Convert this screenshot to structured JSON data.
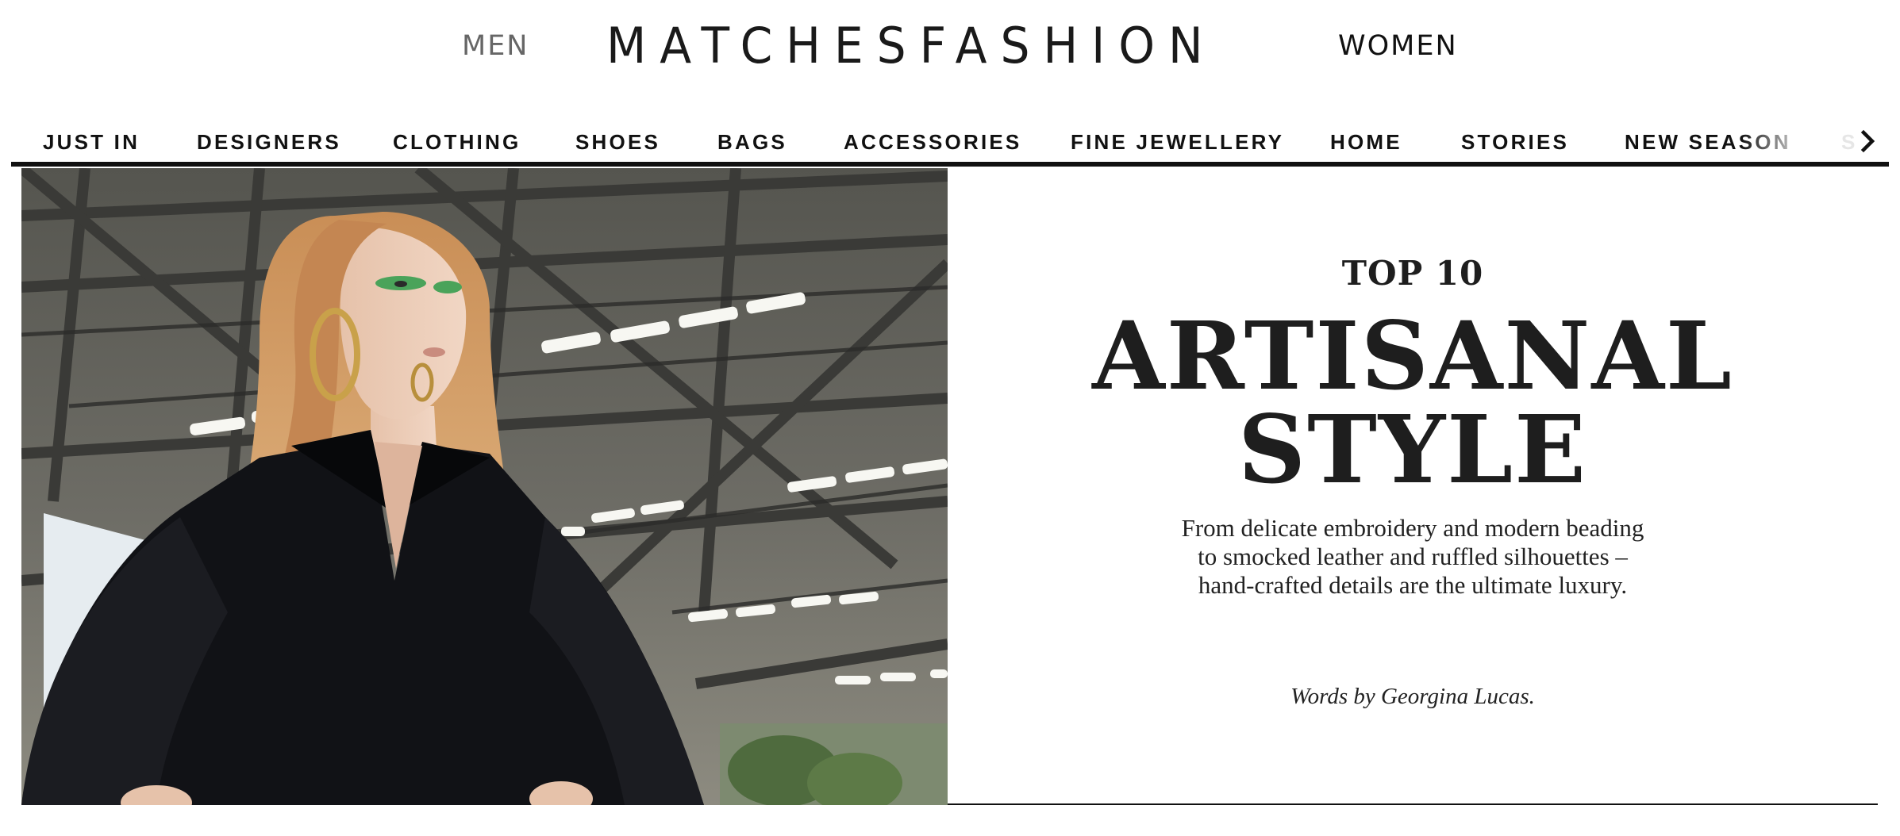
{
  "header": {
    "men_label": "MEN",
    "logo_text": "MATCHESFASHION",
    "women_label": "WOMEN"
  },
  "nav": {
    "items": [
      "JUST IN",
      "DESIGNERS",
      "CLOTHING",
      "SHOES",
      "BAGS",
      "ACCESSORIES",
      "FINE JEWELLERY",
      "HOME",
      "STORIES",
      "NEW SEASON",
      "S"
    ],
    "next_icon": "chevron-right-icon"
  },
  "hero": {
    "image_icon": "runway-photo",
    "kicker": "TOP 10",
    "headline_line1": "ARTISANAL",
    "headline_line2": "STYLE",
    "standfirst": "From delicate embroidery and modern beading to smocked leather and ruffled silhouettes – hand-crafted details are the ultimate luxury.",
    "byline": "Words by Georgina Lucas."
  },
  "colors": {
    "text": "#111111",
    "muted": "#666666",
    "background": "#ffffff"
  }
}
